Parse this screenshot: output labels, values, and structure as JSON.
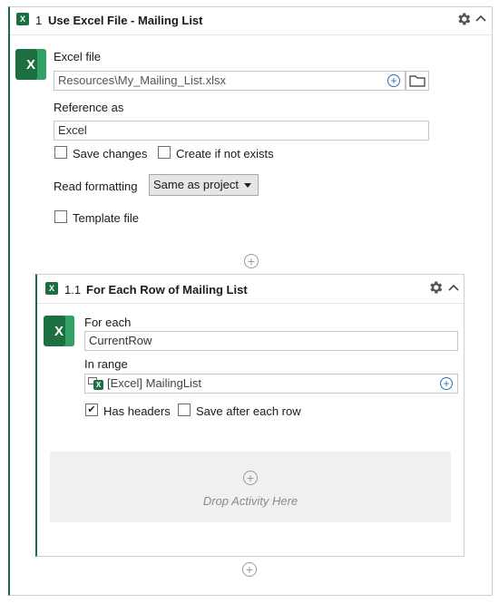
{
  "outer": {
    "index": "1",
    "title": "Use Excel File - Mailing List",
    "excel_file_label": "Excel file",
    "excel_file_value": "Resources\\My_Mailing_List.xlsx",
    "reference_label": "Reference as",
    "reference_value": "Excel",
    "save_changes": "Save changes",
    "create_if_not_exists": "Create if not exists",
    "read_formatting_label": "Read formatting",
    "read_formatting_value": "Same as project",
    "template_file": "Template file"
  },
  "inner": {
    "index": "1.1",
    "title": "For Each Row of Mailing List",
    "for_each_label": "For each",
    "for_each_value": "CurrentRow",
    "in_range_label": "In range",
    "in_range_value": "[Excel] MailingList",
    "has_headers": "Has headers",
    "has_headers_checked": true,
    "save_after_each_row": "Save after each row",
    "drop_text": "Drop Activity Here"
  },
  "icons": {
    "excel": "excel-icon",
    "gear": "gear-icon",
    "chevron": "chevron-up-icon",
    "folder": "folder-icon",
    "plus": "plus-circle-icon"
  },
  "colors": {
    "excel_green": "#1d6f42",
    "accent_blue": "#2e6fb7",
    "sidebar_green": "#1f6a47"
  }
}
